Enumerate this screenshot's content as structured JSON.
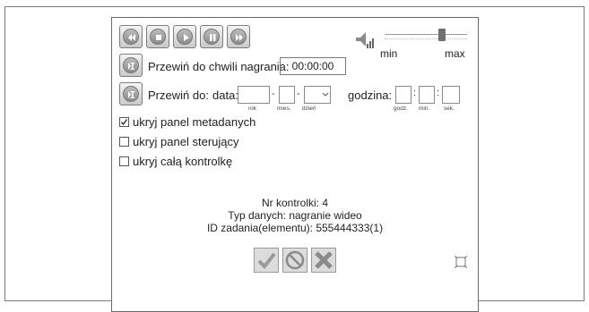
{
  "controls": {
    "rewind": "rewind",
    "stop": "stop",
    "play": "play",
    "pause": "pause",
    "fast_forward": "fast forward"
  },
  "volume": {
    "min_label": "min",
    "max_label": "max",
    "level": 0.72
  },
  "seek_time": {
    "label": "Przewiń do chwili nagrania:",
    "value": "00:00:00"
  },
  "seek_date": {
    "label": "Przewiń do:",
    "date_label": "data:",
    "year_hint": "rok",
    "month_hint": "mies.",
    "day_hint": "dzień",
    "time_label": "godzina:",
    "hour_hint": "godz.",
    "minute_hint": "min.",
    "second_hint": "sek."
  },
  "options": [
    {
      "label": "ukryj panel metadanych",
      "checked": true
    },
    {
      "label": "ukryj panel sterujący",
      "checked": false
    },
    {
      "label": "ukryj całą kontrolkę",
      "checked": false
    }
  ],
  "info": {
    "control_number": "Nr kontrolki: 4",
    "data_type": "Typ danych: nagranie wideo",
    "task_id": "ID zadania(elementu): 555444333(1)"
  }
}
